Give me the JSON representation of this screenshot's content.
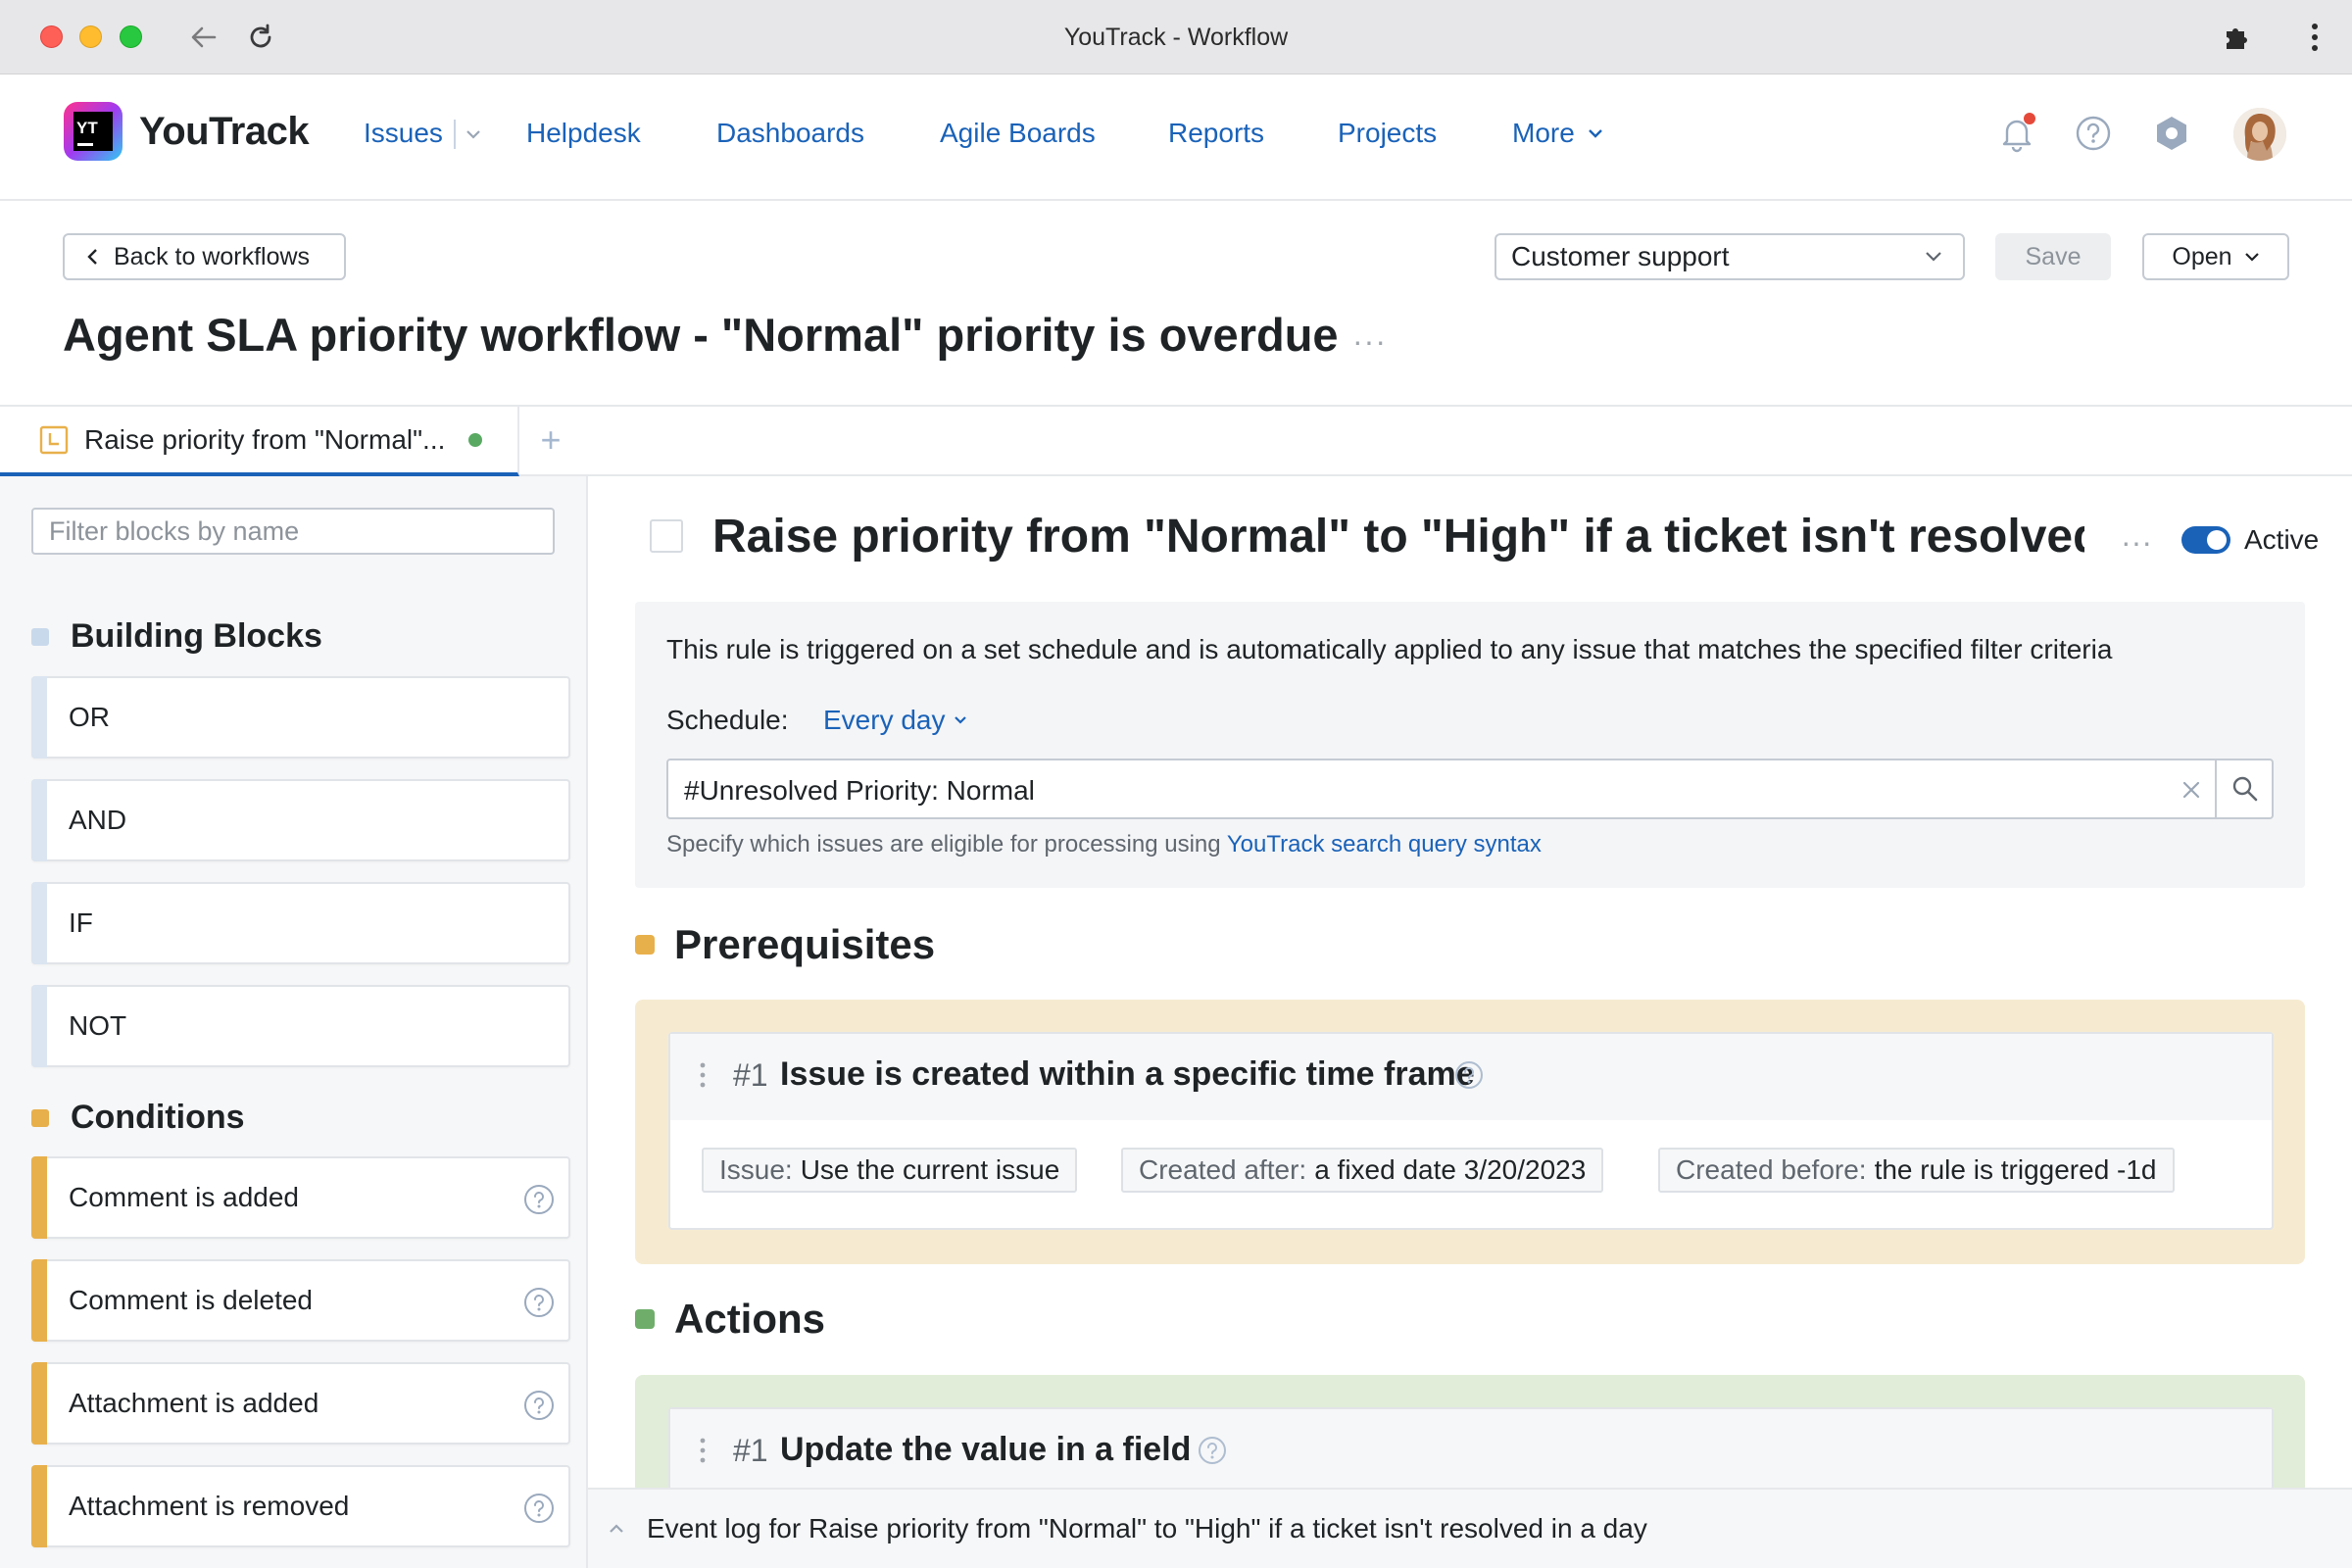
{
  "browser": {
    "title": "YouTrack - Workflow"
  },
  "nav": {
    "brand": "YouTrack",
    "items": [
      "Issues",
      "Helpdesk",
      "Dashboards",
      "Agile Boards",
      "Reports",
      "Projects",
      "More"
    ],
    "notification_badge_color": "#e5493a"
  },
  "header": {
    "back_label": "Back to workflows",
    "project_select": "Customer support",
    "save_label": "Save",
    "open_label": "Open",
    "workflow_title": "Agent SLA priority workflow - \"Normal\" priority is overdue",
    "more": "···"
  },
  "tabs": {
    "active_label": "Raise priority from \"Normal\"...",
    "status_color": "#5aa963",
    "add": "+"
  },
  "sidebar": {
    "filter_placeholder": "Filter blocks by name",
    "sections": [
      {
        "title": "Building Blocks",
        "color": "#c9d9ec",
        "items": [
          "OR",
          "AND",
          "IF",
          "NOT"
        ]
      },
      {
        "title": "Conditions",
        "color": "#e8b04b",
        "items": [
          "Comment is added",
          "Comment is deleted",
          "Attachment is added",
          "Attachment is removed"
        ]
      }
    ]
  },
  "rule": {
    "title": "Raise priority from \"Normal\" to \"High\" if a ticket isn't resolved...",
    "more": "···",
    "active_label": "Active",
    "active": true,
    "description": "This rule is triggered on a set schedule and is automatically applied to any issue that matches the specified filter criteria",
    "schedule_label": "Schedule:",
    "schedule_value": "Every day",
    "query": "#Unresolved Priority: Normal",
    "hint_prefix": "Specify which issues are eligible for processing using ",
    "hint_link": "YouTrack search query syntax"
  },
  "prerequisites": {
    "title": "Prerequisites",
    "color": "#e8b04b",
    "card": {
      "number": "#1",
      "title": "Issue is created within a specific time frame",
      "params": [
        {
          "key": "Issue:",
          "value": "Use the current issue"
        },
        {
          "key": "Created after:",
          "value": "a fixed date 3/20/2023"
        },
        {
          "key": "Created before:",
          "value": "the rule is triggered -1d"
        }
      ]
    }
  },
  "actions": {
    "title": "Actions",
    "color": "#6fae6a",
    "card": {
      "number": "#1",
      "title": "Update the value in a field"
    }
  },
  "event_log": {
    "label": "Event log for Raise priority from \"Normal\" to \"High\" if a ticket isn't resolved in a day"
  }
}
